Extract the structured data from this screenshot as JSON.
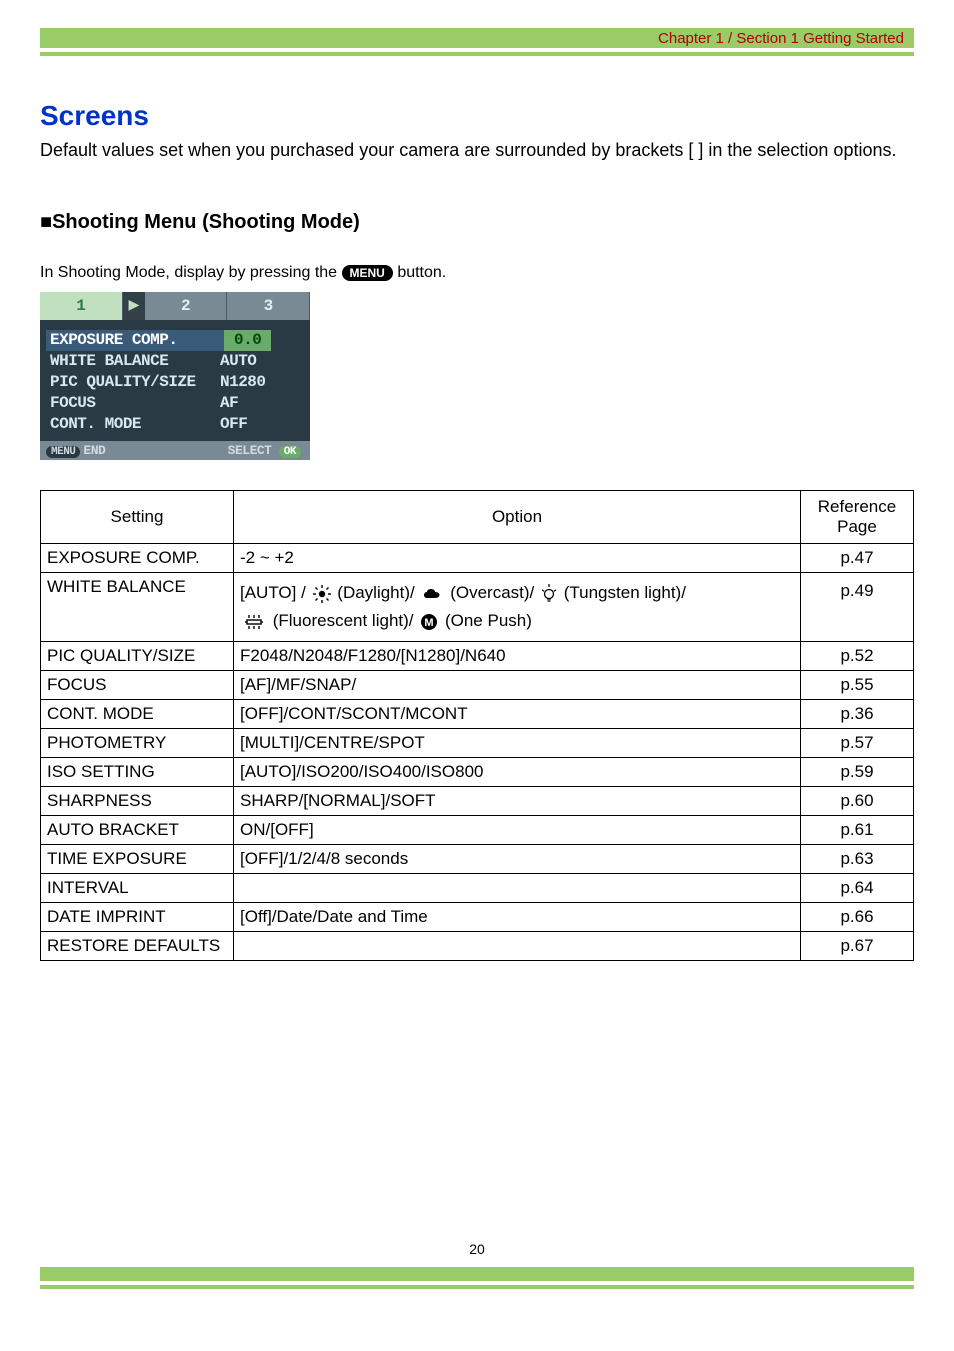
{
  "chapter": "Chapter 1 / Section 1 Getting Started",
  "title": "Screens",
  "intro": "Default values set when you purchased your camera are surrounded by brackets [ ] in the selection options.",
  "subhead": "Shooting Menu (Shooting Mode)",
  "press_before": "In Shooting Mode, display by pressing the ",
  "press_button": "MENU",
  "press_after": " button.",
  "lcd": {
    "tabs": [
      "1",
      "2",
      "3"
    ],
    "rows": [
      {
        "label": "EXPOSURE COMP.",
        "val": "0.0",
        "hl": true
      },
      {
        "label": "WHITE BALANCE",
        "val": "AUTO"
      },
      {
        "label": "PIC QUALITY/SIZE",
        "val": "N1280"
      },
      {
        "label": "FOCUS",
        "val": "AF"
      },
      {
        "label": "CONT. MODE",
        "val": "OFF"
      }
    ],
    "footer_left_pill": "MENU",
    "footer_left": "END",
    "footer_right": "SELECT",
    "footer_right_pill": "OK"
  },
  "table": {
    "headers": {
      "setting": "Setting",
      "option": "Option",
      "ref": "Reference Page"
    },
    "rows": [
      {
        "setting": "EXPOSURE COMP.",
        "option": "-2 ~ +2",
        "ref": "p.47"
      },
      {
        "setting": "WHITE BALANCE",
        "ref": "p.49",
        "wb": {
          "auto": "[AUTO] / ",
          "daylight": " (Daylight)/ ",
          "overcast": " (Overcast)/ ",
          "tungsten": " (Tungsten light)/",
          "fluorescent": " (Fluorescent light)/ ",
          "onepush": " (One Push)"
        }
      },
      {
        "setting": "PIC QUALITY/SIZE",
        "option": "F2048/N2048/F1280/[N1280]/N640",
        "ref": "p.52"
      },
      {
        "setting": "FOCUS",
        "option": "[AF]/MF/SNAP/",
        "ref": "p.55"
      },
      {
        "setting": "CONT. MODE",
        "option": "[OFF]/CONT/SCONT/MCONT",
        "ref": "p.36"
      },
      {
        "setting": "PHOTOMETRY",
        "option": "[MULTI]/CENTRE/SPOT",
        "ref": "p.57"
      },
      {
        "setting": "ISO SETTING",
        "option": "[AUTO]/ISO200/ISO400/ISO800",
        "ref": "p.59"
      },
      {
        "setting": "SHARPNESS",
        "option": "SHARP/[NORMAL]/SOFT",
        "ref": "p.60"
      },
      {
        "setting": "AUTO BRACKET",
        "option": "ON/[OFF]",
        "ref": "p.61"
      },
      {
        "setting": "TIME EXPOSURE",
        "option": "[OFF]/1/2/4/8 seconds",
        "ref": "p.63"
      },
      {
        "setting": "INTERVAL",
        "option": "",
        "ref": "p.64"
      },
      {
        "setting": "DATE IMPRINT",
        "option": "[Off]/Date/Date and Time",
        "ref": "p.66"
      },
      {
        "setting": "RESTORE DEFAULTS",
        "option": "",
        "ref": "p.67"
      }
    ]
  },
  "page_number": "20"
}
